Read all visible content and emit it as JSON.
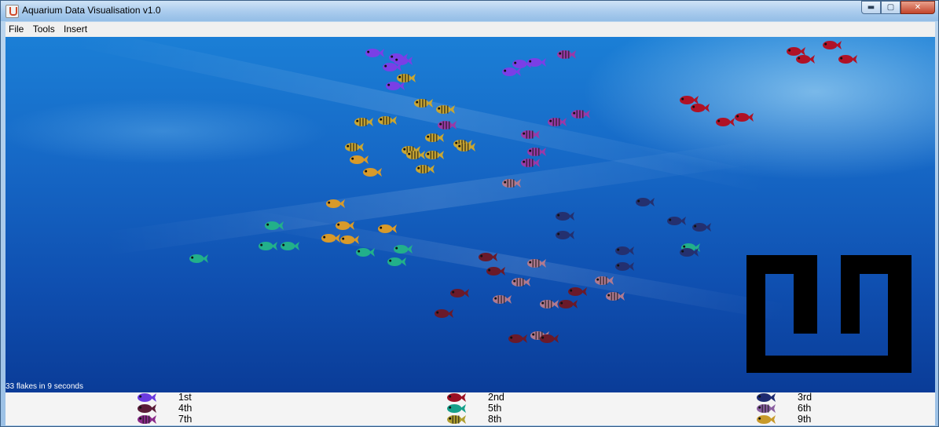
{
  "window": {
    "title": "Aquarium Data Visualisation v1.0"
  },
  "menu": {
    "items": [
      "File",
      "Tools",
      "Insert"
    ]
  },
  "status": {
    "text": "33 flakes in 9 seconds"
  },
  "legend": [
    {
      "label": "1st",
      "color": "#6a3adf",
      "pattern": "solid"
    },
    {
      "label": "2nd",
      "color": "#9a1024",
      "pattern": "solid"
    },
    {
      "label": "3rd",
      "color": "#1e2a70",
      "pattern": "solid"
    },
    {
      "label": "4th",
      "color": "#5a1c38",
      "pattern": "solid"
    },
    {
      "label": "5th",
      "color": "#16a08a",
      "pattern": "solid"
    },
    {
      "label": "6th",
      "color": "#8a5fa0",
      "pattern": "striped"
    },
    {
      "label": "7th",
      "color": "#8a2a8a",
      "pattern": "striped"
    },
    {
      "label": "8th",
      "color": "#b0a030",
      "pattern": "striped"
    },
    {
      "label": "9th",
      "color": "#c89a2a",
      "pattern": "solid"
    }
  ],
  "colors": {
    "water_top": "#1b7fd6",
    "water_bottom": "#0a3c98",
    "legend_bg": "#f4f4f4",
    "logo": "#000000"
  },
  "icons": {
    "app": "java-cup-icon",
    "logo": "square-spiral-logo"
  }
}
